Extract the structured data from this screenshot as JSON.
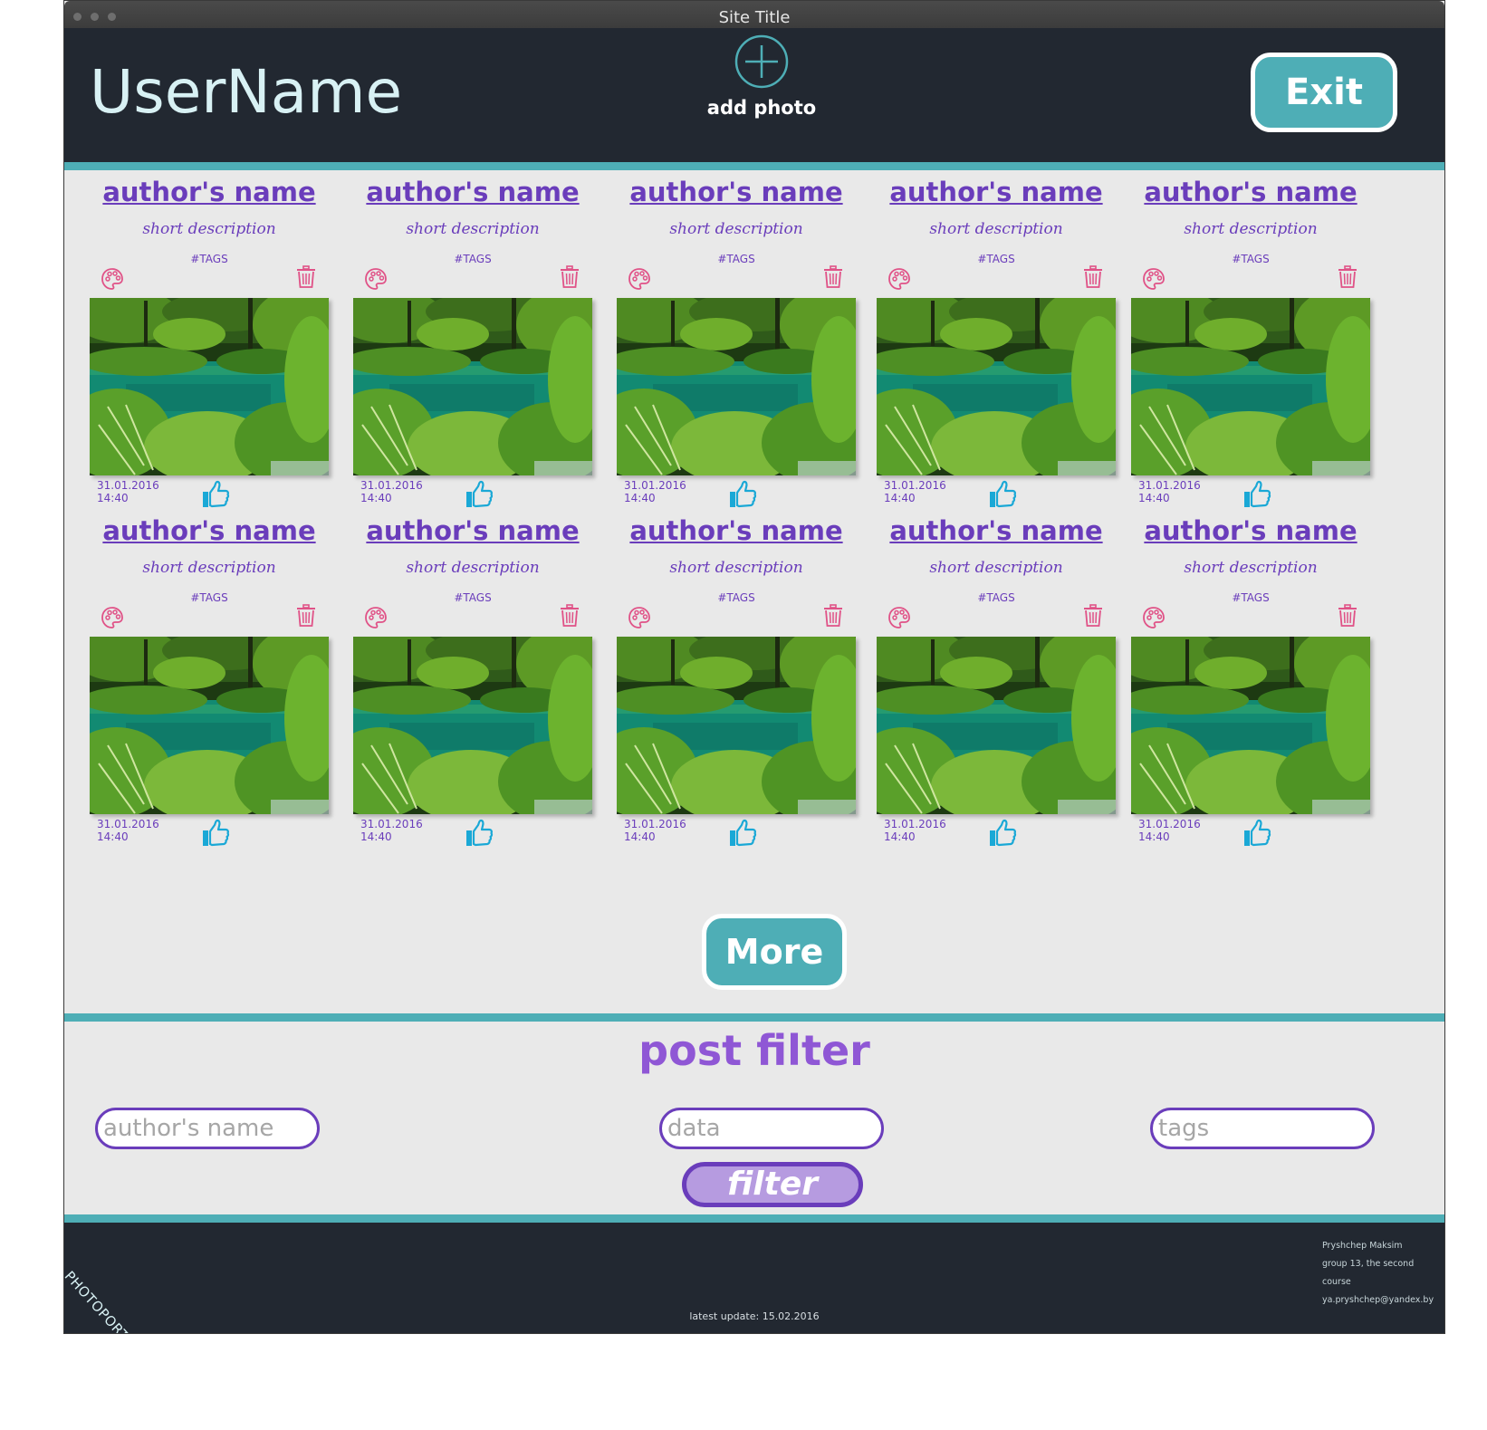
{
  "window": {
    "title": "Site Title"
  },
  "header": {
    "username": "UserName",
    "add_photo_label": "add photo",
    "exit_label": "Exit"
  },
  "posts": [
    {
      "author": "author's name",
      "description": "short description",
      "tags": "#TAGS",
      "date": "31.01.2016",
      "time": "14:40"
    },
    {
      "author": "author's name",
      "description": "short description",
      "tags": "#TAGS",
      "date": "31.01.2016",
      "time": "14:40"
    },
    {
      "author": "author's name",
      "description": "short description",
      "tags": "#TAGS",
      "date": "31.01.2016",
      "time": "14:40"
    },
    {
      "author": "author's name",
      "description": "short description",
      "tags": "#TAGS",
      "date": "31.01.2016",
      "time": "14:40"
    },
    {
      "author": "author's name",
      "description": "short description",
      "tags": "#TAGS",
      "date": "31.01.2016",
      "time": "14:40"
    },
    {
      "author": "author's name",
      "description": "short description",
      "tags": "#TAGS",
      "date": "31.01.2016",
      "time": "14:40"
    },
    {
      "author": "author's name",
      "description": "short description",
      "tags": "#TAGS",
      "date": "31.01.2016",
      "time": "14:40"
    },
    {
      "author": "author's name",
      "description": "short description",
      "tags": "#TAGS",
      "date": "31.01.2016",
      "time": "14:40"
    },
    {
      "author": "author's name",
      "description": "short description",
      "tags": "#TAGS",
      "date": "31.01.2016",
      "time": "14:40"
    },
    {
      "author": "author's name",
      "description": "short description",
      "tags": "#TAGS",
      "date": "31.01.2016",
      "time": "14:40"
    }
  ],
  "more_label": "More",
  "filter": {
    "title": "post filter",
    "author_placeholder": "author's name",
    "data_placeholder": "data",
    "tags_placeholder": "tags",
    "button_label": "filter"
  },
  "footer": {
    "logo": "PHOTOPORTAL",
    "author_name": "Pryshchep Maksim",
    "group": "group 13, the second course",
    "email": "ya.pryshchep@yandex.by",
    "latest_update": "latest update: 15.02.2016"
  },
  "icons": {
    "add": "plus-circle-icon",
    "palette": "palette-icon",
    "trash": "trash-icon",
    "like": "thumbs-up-icon"
  },
  "colors": {
    "header_bg": "#222831",
    "accent_teal": "#4eaeb6",
    "text_purple": "#6a3dbb",
    "icon_pink": "#e05287",
    "like_blue": "#1aa8d6",
    "page_bg": "#e9e9e9"
  }
}
